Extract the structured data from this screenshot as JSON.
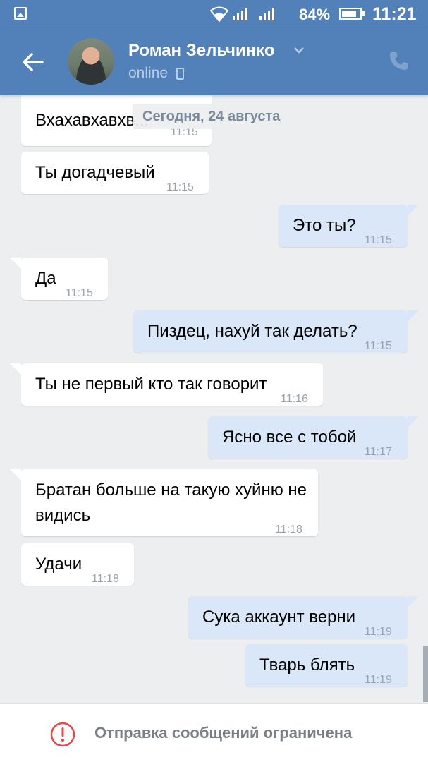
{
  "status_bar": {
    "battery": "84%",
    "battery_level": 0.84,
    "time": "11:21",
    "icons": [
      "gallery-icon",
      "wifi-icon",
      "signal-icon",
      "signal-icon",
      "battery-icon"
    ]
  },
  "header": {
    "contact_name": "Роман Зельчинко",
    "status": "online",
    "icons": [
      "back-arrow-icon",
      "chevron-down-icon",
      "mobile-icon",
      "phone-icon"
    ],
    "bg_color": "#5181b8"
  },
  "chat": {
    "date_separator": "Сегодня, 24 августа",
    "messages": [
      {
        "dir": "in",
        "text": "Вхахавхавхв...",
        "time": "11:15"
      },
      {
        "dir": "in",
        "text": "Ты догадчевый",
        "time": "11:15"
      },
      {
        "dir": "out",
        "text": "Это ты?",
        "time": "11:15"
      },
      {
        "dir": "in",
        "text": "Да",
        "time": "11:15"
      },
      {
        "dir": "out",
        "text": "Пиздец, нахуй так делать?",
        "time": "11:15"
      },
      {
        "dir": "in",
        "text": "Ты не первый кто так говорит",
        "time": "11:16"
      },
      {
        "dir": "out",
        "text": "Ясно все с тобой",
        "time": "11:17"
      },
      {
        "dir": "in",
        "text": "Братан больше на такую хуйню не видись",
        "time": "11:18"
      },
      {
        "dir": "in",
        "text": "Удачи",
        "time": "11:18"
      },
      {
        "dir": "out",
        "text": "Сука аккаунт верни",
        "time": "11:19"
      },
      {
        "dir": "out",
        "text": "Тварь блять",
        "time": "11:19"
      }
    ]
  },
  "footer": {
    "restriction_text": "Отправка сообщений ограничена",
    "icon": "exclamation-circle-icon",
    "icon_color": "#e64646"
  }
}
